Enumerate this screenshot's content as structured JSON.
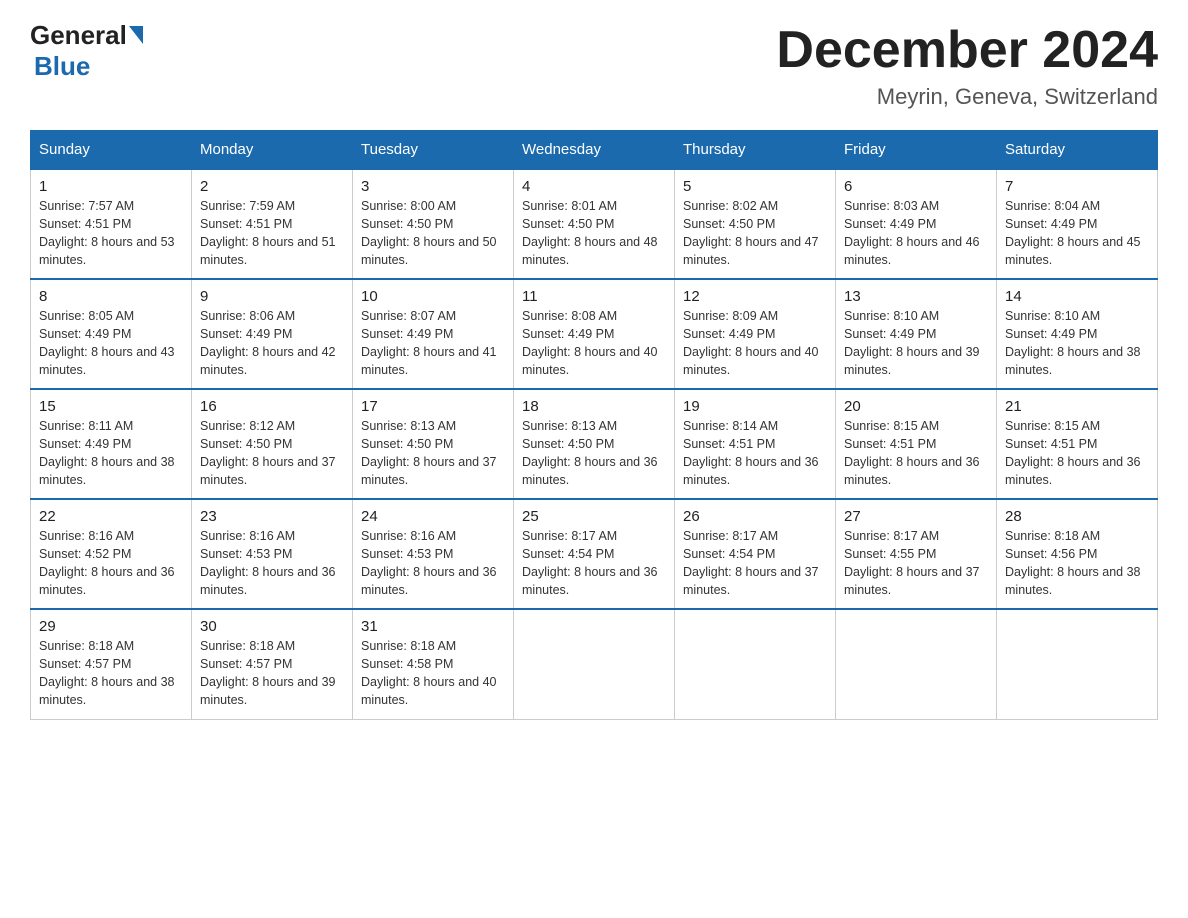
{
  "header": {
    "logo_general": "General",
    "logo_blue": "Blue",
    "title": "December 2024",
    "subtitle": "Meyrin, Geneva, Switzerland"
  },
  "days_of_week": [
    "Sunday",
    "Monday",
    "Tuesday",
    "Wednesday",
    "Thursday",
    "Friday",
    "Saturday"
  ],
  "weeks": [
    [
      {
        "num": "1",
        "sunrise": "7:57 AM",
        "sunset": "4:51 PM",
        "daylight": "8 hours and 53 minutes."
      },
      {
        "num": "2",
        "sunrise": "7:59 AM",
        "sunset": "4:51 PM",
        "daylight": "8 hours and 51 minutes."
      },
      {
        "num": "3",
        "sunrise": "8:00 AM",
        "sunset": "4:50 PM",
        "daylight": "8 hours and 50 minutes."
      },
      {
        "num": "4",
        "sunrise": "8:01 AM",
        "sunset": "4:50 PM",
        "daylight": "8 hours and 48 minutes."
      },
      {
        "num": "5",
        "sunrise": "8:02 AM",
        "sunset": "4:50 PM",
        "daylight": "8 hours and 47 minutes."
      },
      {
        "num": "6",
        "sunrise": "8:03 AM",
        "sunset": "4:49 PM",
        "daylight": "8 hours and 46 minutes."
      },
      {
        "num": "7",
        "sunrise": "8:04 AM",
        "sunset": "4:49 PM",
        "daylight": "8 hours and 45 minutes."
      }
    ],
    [
      {
        "num": "8",
        "sunrise": "8:05 AM",
        "sunset": "4:49 PM",
        "daylight": "8 hours and 43 minutes."
      },
      {
        "num": "9",
        "sunrise": "8:06 AM",
        "sunset": "4:49 PM",
        "daylight": "8 hours and 42 minutes."
      },
      {
        "num": "10",
        "sunrise": "8:07 AM",
        "sunset": "4:49 PM",
        "daylight": "8 hours and 41 minutes."
      },
      {
        "num": "11",
        "sunrise": "8:08 AM",
        "sunset": "4:49 PM",
        "daylight": "8 hours and 40 minutes."
      },
      {
        "num": "12",
        "sunrise": "8:09 AM",
        "sunset": "4:49 PM",
        "daylight": "8 hours and 40 minutes."
      },
      {
        "num": "13",
        "sunrise": "8:10 AM",
        "sunset": "4:49 PM",
        "daylight": "8 hours and 39 minutes."
      },
      {
        "num": "14",
        "sunrise": "8:10 AM",
        "sunset": "4:49 PM",
        "daylight": "8 hours and 38 minutes."
      }
    ],
    [
      {
        "num": "15",
        "sunrise": "8:11 AM",
        "sunset": "4:49 PM",
        "daylight": "8 hours and 38 minutes."
      },
      {
        "num": "16",
        "sunrise": "8:12 AM",
        "sunset": "4:50 PM",
        "daylight": "8 hours and 37 minutes."
      },
      {
        "num": "17",
        "sunrise": "8:13 AM",
        "sunset": "4:50 PM",
        "daylight": "8 hours and 37 minutes."
      },
      {
        "num": "18",
        "sunrise": "8:13 AM",
        "sunset": "4:50 PM",
        "daylight": "8 hours and 36 minutes."
      },
      {
        "num": "19",
        "sunrise": "8:14 AM",
        "sunset": "4:51 PM",
        "daylight": "8 hours and 36 minutes."
      },
      {
        "num": "20",
        "sunrise": "8:15 AM",
        "sunset": "4:51 PM",
        "daylight": "8 hours and 36 minutes."
      },
      {
        "num": "21",
        "sunrise": "8:15 AM",
        "sunset": "4:51 PM",
        "daylight": "8 hours and 36 minutes."
      }
    ],
    [
      {
        "num": "22",
        "sunrise": "8:16 AM",
        "sunset": "4:52 PM",
        "daylight": "8 hours and 36 minutes."
      },
      {
        "num": "23",
        "sunrise": "8:16 AM",
        "sunset": "4:53 PM",
        "daylight": "8 hours and 36 minutes."
      },
      {
        "num": "24",
        "sunrise": "8:16 AM",
        "sunset": "4:53 PM",
        "daylight": "8 hours and 36 minutes."
      },
      {
        "num": "25",
        "sunrise": "8:17 AM",
        "sunset": "4:54 PM",
        "daylight": "8 hours and 36 minutes."
      },
      {
        "num": "26",
        "sunrise": "8:17 AM",
        "sunset": "4:54 PM",
        "daylight": "8 hours and 37 minutes."
      },
      {
        "num": "27",
        "sunrise": "8:17 AM",
        "sunset": "4:55 PM",
        "daylight": "8 hours and 37 minutes."
      },
      {
        "num": "28",
        "sunrise": "8:18 AM",
        "sunset": "4:56 PM",
        "daylight": "8 hours and 38 minutes."
      }
    ],
    [
      {
        "num": "29",
        "sunrise": "8:18 AM",
        "sunset": "4:57 PM",
        "daylight": "8 hours and 38 minutes."
      },
      {
        "num": "30",
        "sunrise": "8:18 AM",
        "sunset": "4:57 PM",
        "daylight": "8 hours and 39 minutes."
      },
      {
        "num": "31",
        "sunrise": "8:18 AM",
        "sunset": "4:58 PM",
        "daylight": "8 hours and 40 minutes."
      },
      null,
      null,
      null,
      null
    ]
  ]
}
